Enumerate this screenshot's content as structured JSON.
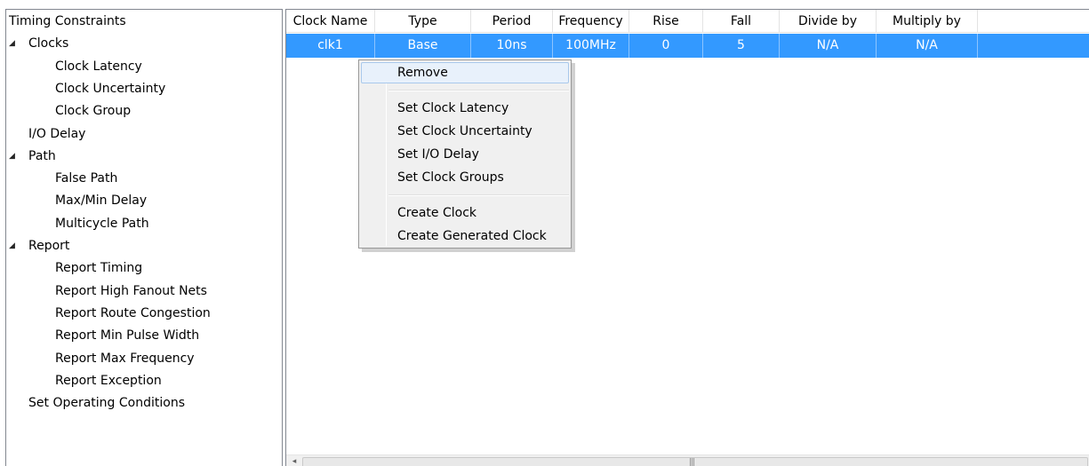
{
  "tree": {
    "items": [
      {
        "label": "Timing Constraints",
        "level": 0,
        "expander": ""
      },
      {
        "label": "Clocks",
        "level": 1,
        "expander": "◢"
      },
      {
        "label": "Clock Latency",
        "level": 2,
        "expander": ""
      },
      {
        "label": "Clock Uncertainty",
        "level": 2,
        "expander": ""
      },
      {
        "label": "Clock Group",
        "level": 2,
        "expander": ""
      },
      {
        "label": "I/O Delay",
        "level": 1,
        "expander": ""
      },
      {
        "label": "Path",
        "level": 1,
        "expander": "◢"
      },
      {
        "label": "False Path",
        "level": 2,
        "expander": ""
      },
      {
        "label": "Max/Min Delay",
        "level": 2,
        "expander": ""
      },
      {
        "label": "Multicycle Path",
        "level": 2,
        "expander": ""
      },
      {
        "label": "Report",
        "level": 1,
        "expander": "◢"
      },
      {
        "label": "Report Timing",
        "level": 2,
        "expander": ""
      },
      {
        "label": "Report High Fanout Nets",
        "level": 2,
        "expander": ""
      },
      {
        "label": "Report Route Congestion",
        "level": 2,
        "expander": ""
      },
      {
        "label": "Report Min Pulse Width",
        "level": 2,
        "expander": ""
      },
      {
        "label": "Report Max Frequency",
        "level": 2,
        "expander": ""
      },
      {
        "label": "Report Exception",
        "level": 2,
        "expander": ""
      },
      {
        "label": "Set Operating Conditions",
        "level": 1,
        "expander": ""
      }
    ]
  },
  "grid": {
    "columns": [
      "Clock Name",
      "Type",
      "Period",
      "Frequency",
      "Rise",
      "Fall",
      "Divide by",
      "Multiply by"
    ],
    "rows": [
      [
        "clk1",
        "Base",
        "10ns",
        "100MHz",
        "0",
        "5",
        "N/A",
        "N/A"
      ]
    ],
    "selected_row": 0,
    "selection_color": "#3399ff"
  },
  "context_menu": {
    "groups": [
      [
        "Remove"
      ],
      [
        "Set Clock Latency",
        "Set Clock Uncertainty",
        "Set I/O Delay",
        "Set Clock Groups"
      ],
      [
        "Create Clock",
        "Create Generated Clock"
      ]
    ],
    "hovered": "Remove"
  },
  "scrollbar": {
    "left_arrow": "◂",
    "grip": "|||"
  }
}
